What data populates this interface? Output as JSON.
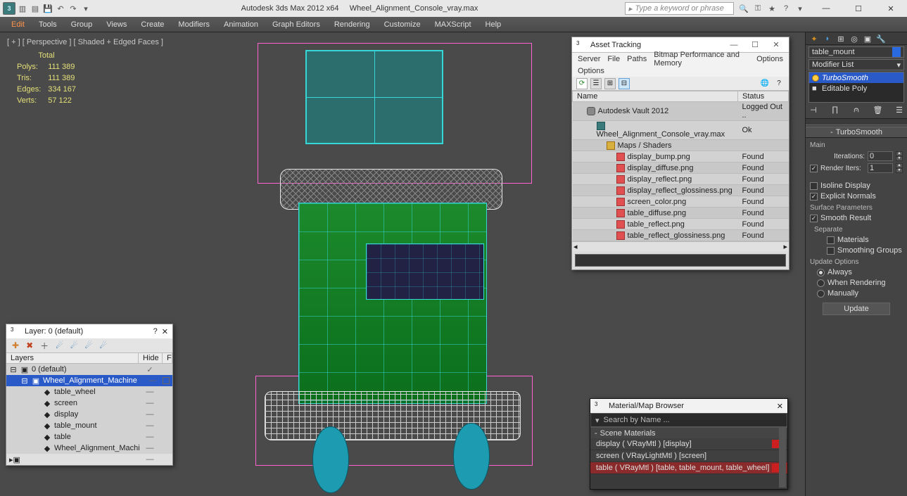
{
  "titlebar": {
    "app": "Autodesk 3ds Max  2012 x64",
    "file": "Wheel_Alignment_Console_vray.max",
    "search_placeholder": "Type a keyword or phrase"
  },
  "menu": [
    "Edit",
    "Tools",
    "Group",
    "Views",
    "Create",
    "Modifiers",
    "Animation",
    "Graph Editors",
    "Rendering",
    "Customize",
    "MAXScript",
    "Help"
  ],
  "viewport": {
    "label": "[ + ]  [ Perspective ]  [ Shaded + Edged Faces ]",
    "stats": {
      "title": "Total",
      "rows": [
        {
          "k": "Polys:",
          "v": "111 389"
        },
        {
          "k": "Tris:",
          "v": "111 389"
        },
        {
          "k": "Edges:",
          "v": "334 167"
        },
        {
          "k": "Verts:",
          "v": "57 122"
        }
      ]
    }
  },
  "asset_panel": {
    "title": "Asset Tracking",
    "menu": [
      "Server",
      "File",
      "Paths",
      "Bitmap Performance and Memory",
      "Options"
    ],
    "cols": {
      "name": "Name",
      "status": "Status"
    },
    "rows": [
      {
        "icon": "cloud",
        "indent": 1,
        "name": "Autodesk Vault 2012",
        "status": "Logged Out ..",
        "dark": true
      },
      {
        "icon": "max",
        "indent": 2,
        "name": "Wheel_Alignment_Console_vray.max",
        "status": "Ok",
        "dark": false
      },
      {
        "icon": "fold",
        "indent": 3,
        "name": "Maps / Shaders",
        "status": "",
        "dark": true
      },
      {
        "icon": "png",
        "indent": 4,
        "name": "display_bump.png",
        "status": "Found",
        "dark": false
      },
      {
        "icon": "png",
        "indent": 4,
        "name": "display_diffuse.png",
        "status": "Found",
        "dark": true
      },
      {
        "icon": "png",
        "indent": 4,
        "name": "display_reflect.png",
        "status": "Found",
        "dark": false
      },
      {
        "icon": "png",
        "indent": 4,
        "name": "display_reflect_glossiness.png",
        "status": "Found",
        "dark": true
      },
      {
        "icon": "png",
        "indent": 4,
        "name": "screen_color.png",
        "status": "Found",
        "dark": false
      },
      {
        "icon": "png",
        "indent": 4,
        "name": "table_diffuse.png",
        "status": "Found",
        "dark": true
      },
      {
        "icon": "png",
        "indent": 4,
        "name": "table_reflect.png",
        "status": "Found",
        "dark": false
      },
      {
        "icon": "png",
        "indent": 4,
        "name": "table_reflect_glossiness.png",
        "status": "Found",
        "dark": true
      }
    ]
  },
  "layer_panel": {
    "title": "Layer: 0 (default)",
    "cols": {
      "layers": "Layers",
      "hide": "Hide",
      "f": "F"
    },
    "rows": [
      {
        "icon": "▣",
        "name": "0 (default)",
        "indent": 0,
        "sel": false,
        "check": true
      },
      {
        "icon": "▣",
        "name": "Wheel_Alignment_Machine",
        "indent": 1,
        "sel": true,
        "box": true
      },
      {
        "icon": "◆",
        "name": "table_wheel",
        "indent": 2
      },
      {
        "icon": "◆",
        "name": "screen",
        "indent": 2
      },
      {
        "icon": "◆",
        "name": "display",
        "indent": 2
      },
      {
        "icon": "◆",
        "name": "table_mount",
        "indent": 2
      },
      {
        "icon": "◆",
        "name": "table",
        "indent": 2
      },
      {
        "icon": "◆",
        "name": "Wheel_Alignment_Machine",
        "indent": 2
      }
    ]
  },
  "mat_panel": {
    "title": "Material/Map Browser",
    "search": "Search by Name ...",
    "section": "Scene Materials",
    "rows": [
      {
        "text": "display  ( VRayMtl )  [display]",
        "swatch": true
      },
      {
        "text": "screen  ( VRayLightMtl )  [screen]"
      },
      {
        "text": "table  ( VRayMtl )  [table, table_mount, table_wheel]",
        "sel": true,
        "swatch": true
      }
    ]
  },
  "cmd": {
    "sel_name": "table_mount",
    "mod_list": "Modifier List",
    "stack": [
      {
        "name": "TurboSmooth",
        "sel": true,
        "bulb": true
      },
      {
        "name": "Editable Poly",
        "sel": false,
        "bulb": false
      }
    ],
    "rollout": "TurboSmooth",
    "main": "Main",
    "iterations": {
      "label": "Iterations:",
      "value": "0"
    },
    "render_iters": {
      "label": "Render Iters:",
      "value": "1",
      "checked": true
    },
    "isoline": {
      "label": "Isoline Display",
      "checked": false
    },
    "explicit": {
      "label": "Explicit Normals",
      "checked": true
    },
    "surf": "Surface Parameters",
    "smooth_result": {
      "label": "Smooth Result",
      "checked": true
    },
    "separate": "Separate",
    "sep_materials": {
      "label": "Materials",
      "checked": false
    },
    "sep_groups": {
      "label": "Smoothing Groups",
      "checked": false
    },
    "update": "Update Options",
    "upd_always": "Always",
    "upd_render": "When Rendering",
    "upd_manual": "Manually",
    "upd_btn": "Update"
  }
}
